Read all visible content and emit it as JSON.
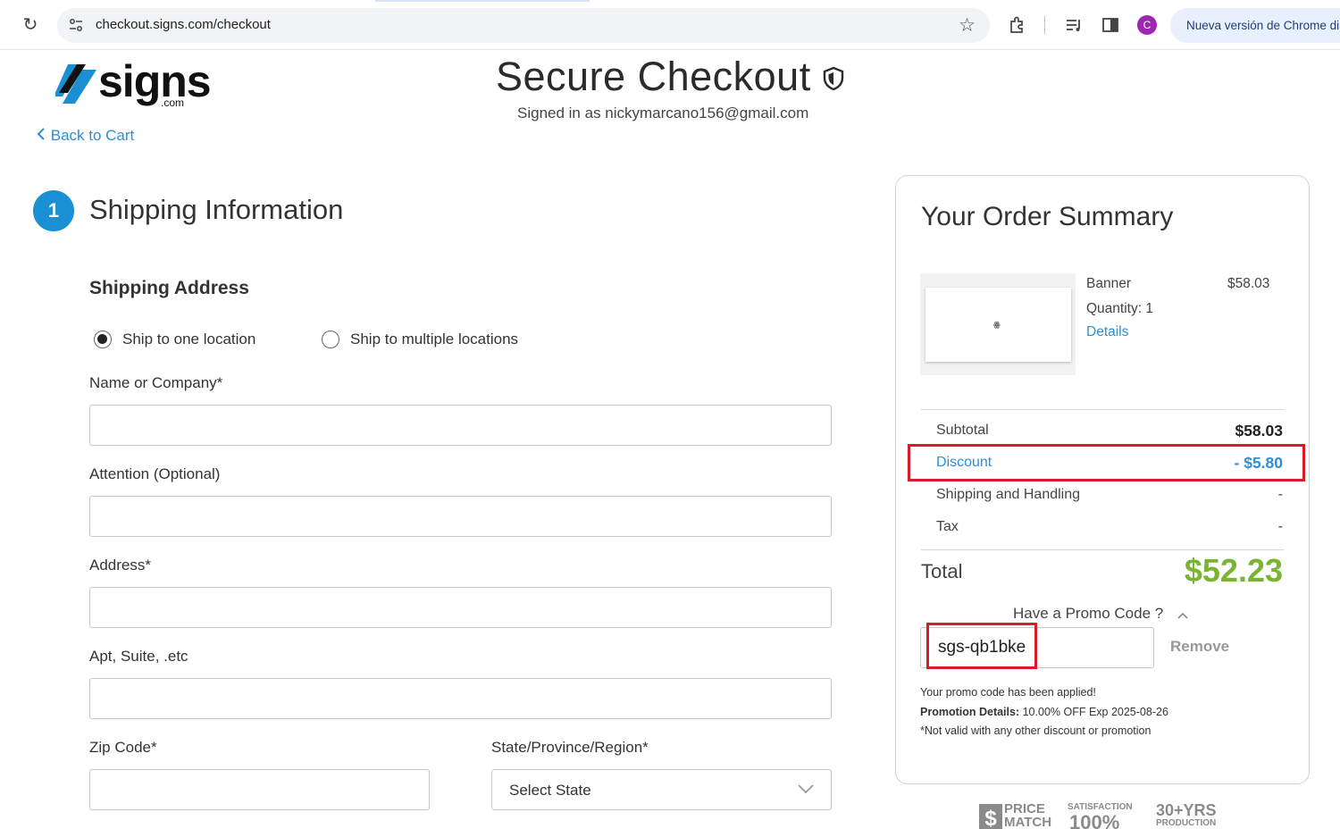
{
  "browser": {
    "url": "checkout.signs.com/checkout",
    "avatar_letter": "C",
    "update_text": "Nueva versión de Chrome di"
  },
  "header": {
    "logo_text": "signs",
    "logo_suffix": ".com",
    "back_link": "Back to Cart",
    "title": "Secure Checkout",
    "signed_in": "Signed in as nickymarcano156@gmail.com"
  },
  "shipping": {
    "step_number": "1",
    "section_title": "Shipping Information",
    "address_title": "Shipping Address",
    "options": [
      {
        "label": "Ship to one location",
        "checked": true
      },
      {
        "label": "Ship to multiple locations",
        "checked": false
      }
    ],
    "fields": {
      "name_label": "Name or Company*",
      "name_value": "",
      "attention_label": "Attention (Optional)",
      "attention_value": "",
      "address_label": "Address*",
      "address_value": "",
      "apt_label": "Apt, Suite, .etc",
      "apt_value": "",
      "zip_label": "Zip Code*",
      "zip_value": "",
      "state_label": "State/Province/Region*",
      "state_value": "Select State"
    }
  },
  "summary": {
    "title": "Your Order Summary",
    "item": {
      "name": "Banner",
      "price": "$58.03",
      "quantity": "Quantity: 1",
      "details_link": "Details"
    },
    "subtotal_label": "Subtotal",
    "subtotal_value": "$58.03",
    "discount_label": "Discount",
    "discount_value": "- $5.80",
    "shipping_label": "Shipping and Handling",
    "shipping_value": "-",
    "tax_label": "Tax",
    "tax_value": "-",
    "total_label": "Total",
    "total_value": "$52.23",
    "promo_toggle": "Have a Promo Code ?",
    "promo_code": "sgs-qb1bke",
    "remove_label": "Remove",
    "promo_applied": "Your promo code has been applied!",
    "promo_details_label": "Promotion Details:",
    "promo_details_value": "10.00% OFF Exp 2025-08-26",
    "promo_note": "*Not valid with any other discount or promotion"
  },
  "badges": {
    "price_match_1": "PRICE",
    "price_match_2": "MATCH",
    "satisfaction_label": "SATISFACTION",
    "satisfaction_value": "100%",
    "years_label": "30+YRS",
    "years_sub": "PRODUCTION"
  },
  "colors": {
    "accent_blue": "#1a8fd3",
    "link_blue": "#2d8fd5",
    "total_green": "#7ab531",
    "highlight_red": "#d91c2a"
  }
}
